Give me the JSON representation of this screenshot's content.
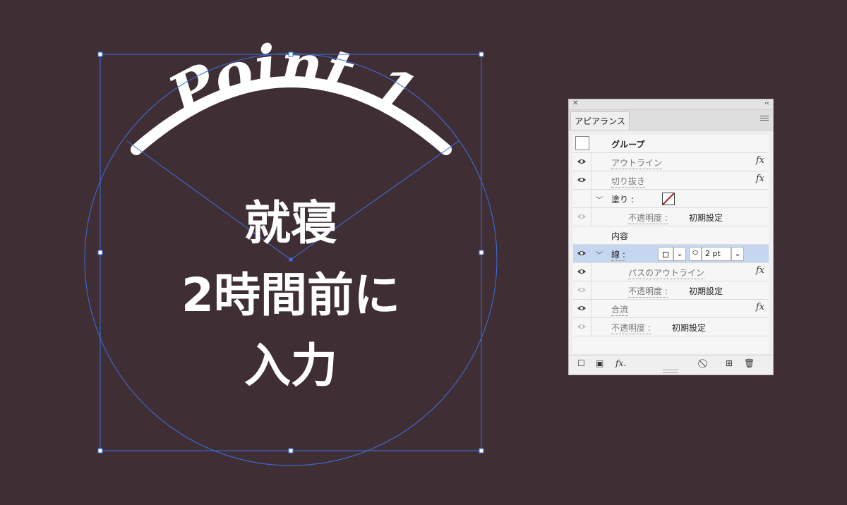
{
  "canvas": {
    "arc_title": "Point 1",
    "body_lines": [
      "就寝",
      "2時間前に",
      "入力"
    ],
    "background": "#3f2f35",
    "text_color": "#ffffff",
    "selection_color": "#3b6fe0"
  },
  "panel": {
    "close_icon": "close-icon",
    "collapse_icon": "double-chevron-icon",
    "tab_label": "アピアランス",
    "rows": {
      "group": {
        "label": "グループ"
      },
      "outline": {
        "label": "アウトライン",
        "fx": "fx"
      },
      "crop": {
        "label": "切り抜き",
        "fx": "fx"
      },
      "fill": {
        "label": "塗り :"
      },
      "fill_opacity": {
        "label": "不透明度 :",
        "value": "初期設定"
      },
      "contents": {
        "label": "内容"
      },
      "stroke": {
        "label": "線 :",
        "weight": "2 pt"
      },
      "path_outline": {
        "label": "パスのアウトライン",
        "fx": "fx"
      },
      "stroke_opacity": {
        "label": "不透明度 :",
        "value": "初期設定"
      },
      "merge": {
        "label": "合流",
        "fx": "fx"
      },
      "opacity": {
        "label": "不透明度 :",
        "value": "初期設定"
      }
    },
    "footer": {
      "fx_label": "fx."
    }
  }
}
